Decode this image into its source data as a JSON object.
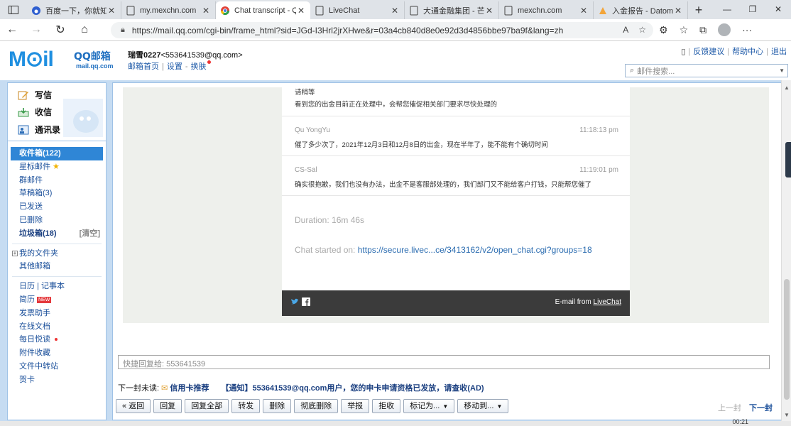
{
  "browser": {
    "tabs": [
      {
        "title": "百度一下，你就知道",
        "icon": "baidu-icon",
        "active": false
      },
      {
        "title": "my.mexchn.com",
        "icon": "page-icon",
        "active": false
      },
      {
        "title": "Chat transcript - Q",
        "icon": "chrome-icon",
        "active": true
      },
      {
        "title": "LiveChat",
        "icon": "page-icon",
        "active": false
      },
      {
        "title": "大通金融集团 - 芒",
        "icon": "page-icon",
        "active": false
      },
      {
        "title": "mexchn.com",
        "icon": "page-icon",
        "active": false
      },
      {
        "title": "入金报告 - Datom",
        "icon": "datom-icon",
        "active": false
      }
    ],
    "url": "https://mail.qq.com/cgi-bin/frame_html?sid=JGd-I3Hrl2jrXHwe&r=03a4cb840d8e0e92d3d4856bbe97ba9f&lang=zh"
  },
  "header": {
    "logo_text": "M⊙il",
    "logo_brand": "QQ邮箱",
    "logo_domain": "mail.qq.com",
    "user_name": "瑞雪0227",
    "user_email": "<553641539@qq.com>",
    "links": [
      "邮箱首页",
      "设置",
      "换肤"
    ],
    "top_links": [
      "反馈建议",
      "帮助中心",
      "退出"
    ],
    "search_placeholder": "邮件搜索..."
  },
  "sidebar": {
    "quick": [
      {
        "label": "写信",
        "icon": "compose-icon"
      },
      {
        "label": "收信",
        "icon": "inbox-icon"
      },
      {
        "label": "通讯录",
        "icon": "contacts-icon"
      }
    ],
    "folders": [
      {
        "label": "收件箱(122)",
        "selected": true
      },
      {
        "label": "星标邮件"
      },
      {
        "label": "群邮件"
      },
      {
        "label": "草稿箱(3)"
      },
      {
        "label": "已发送"
      },
      {
        "label": "已删除"
      },
      {
        "label": "垃圾箱(18)",
        "extra": "[清空]"
      }
    ],
    "folders2": [
      {
        "label": "我的文件夹"
      },
      {
        "label": "其他邮箱"
      }
    ],
    "apps": [
      {
        "label": "日历  |  记事本"
      },
      {
        "label": "简历",
        "badge": "NEW"
      },
      {
        "label": "发票助手"
      },
      {
        "label": "在线文档"
      },
      {
        "label": "每日悦读"
      },
      {
        "label": "附件收藏"
      },
      {
        "label": "文件中转站"
      },
      {
        "label": "贺卡"
      }
    ]
  },
  "transcript": {
    "messages": [
      {
        "who": "",
        "time": "",
        "lines": [
          "请稍等",
          "看到您的出金目前正在处理中，会帮您催促相关部门要求尽快处理的"
        ]
      },
      {
        "who": "Qu YongYu",
        "time": "11:18:13 pm",
        "lines": [
          "催了多少次了，2021年12月3日和12月8日的出金，现在半年了，能不能有个确切时间"
        ]
      },
      {
        "who": "CS-Sal",
        "time": "11:19:01 pm",
        "lines": [
          "确实很抱歉，我们也没有办法，出金不是客服部处理的，我们部门又不能给客户打钱，只能帮您催了"
        ]
      }
    ],
    "duration": "Duration: 16m 46s",
    "started_label": "Chat started on:",
    "started_link": "https://secure.livec...ce/3413162/v2/open_chat.cgi?groups=18",
    "footer_from": "E-mail from",
    "footer_brand": "LiveChat"
  },
  "reply": {
    "placeholder": "快捷回复给: 553641539"
  },
  "next_unread": {
    "label": "下一封未读:",
    "card_label": "信用卡推荐",
    "ad_text": "【通知】553641539@qq.com用户，您的申卡申请资格已发放，请查收(AD)"
  },
  "toolbar": {
    "buttons": [
      "« 返回",
      "回复",
      "回复全部",
      "转发",
      "删除",
      "彻底删除",
      "举报",
      "拒收",
      "标记为...",
      "移动到..."
    ],
    "prev": "上一封",
    "next": "下一封"
  },
  "clock": "00:21"
}
